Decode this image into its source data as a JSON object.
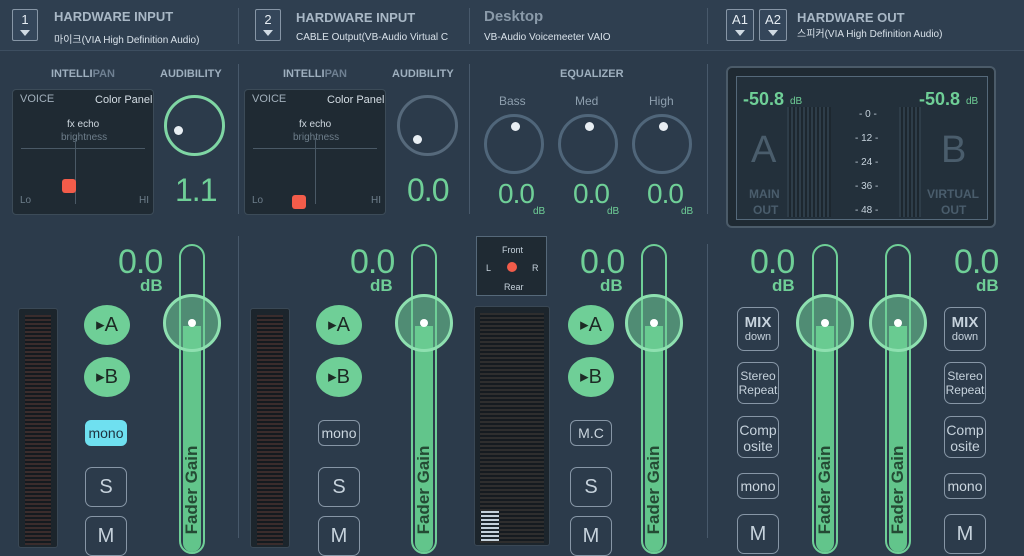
{
  "header": {
    "strip1": {
      "num": "1",
      "title": "HARDWARE INPUT",
      "device": "마이크(VIA High Definition Audio)"
    },
    "strip2": {
      "num": "2",
      "title": "HARDWARE INPUT",
      "device": "CABLE Output(VB-Audio Virtual C"
    },
    "virtual": {
      "title": "Desktop",
      "device": "VB-Audio Voicemeeter VAIO"
    },
    "out": {
      "a1": "A1",
      "a2": "A2",
      "title": "HARDWARE OUT",
      "device": "스피커(VIA High Definition Audio)"
    }
  },
  "strip1": {
    "intellipan_a": "INTELLI",
    "intellipan_b": "PAN",
    "audibility_label": "AUDIBILITY",
    "voice": "VOICE",
    "color_panel": "Color Panel",
    "fx": "fx echo",
    "bright": "brightness",
    "lo": "Lo",
    "hi": "HI",
    "audibility_value": "1.1",
    "gain": "0.0",
    "gain_unit": "dB",
    "bus_a": "A",
    "bus_b": "B",
    "mono": "mono",
    "solo": "S",
    "mute": "M",
    "fader": "Fader Gain"
  },
  "strip2": {
    "intellipan_a": "INTELLI",
    "intellipan_b": "PAN",
    "audibility_label": "AUDIBILITY",
    "voice": "VOICE",
    "color_panel": "Color Panel",
    "fx": "fx echo",
    "bright": "brightness",
    "lo": "Lo",
    "hi": "HI",
    "audibility_value": "0.0",
    "gain": "0.0",
    "gain_unit": "dB",
    "bus_a": "A",
    "bus_b": "B",
    "mono": "mono",
    "solo": "S",
    "mute": "M",
    "fader": "Fader Gain"
  },
  "virtual": {
    "eq_label": "EQUALIZER",
    "bass": "Bass",
    "med": "Med",
    "high": "High",
    "bass_val": "0.0",
    "med_val": "0.0",
    "high_val": "0.0",
    "db": "dB",
    "front": "Front",
    "rear": "Rear",
    "l": "L",
    "r": "R",
    "gain": "0.0",
    "gain_unit": "dB",
    "bus_a": "A",
    "bus_b": "B",
    "mc": "M.C",
    "solo": "S",
    "mute": "M",
    "fader": "Fader Gain"
  },
  "out": {
    "level_a": "-50.8",
    "level_b": "-50.8",
    "db": "dB",
    "big_a": "A",
    "big_b": "B",
    "main": "MAIN",
    "out_word": "OUT",
    "virtual_word": "VIRTUAL",
    "scale": [
      "- 0 -",
      "- 12 -",
      "- 24 -",
      "- 36 -",
      "- 48 -"
    ],
    "a1_gain": "0.0",
    "a2_gain": "0.0",
    "gain_unit": "dB",
    "mix": "MIX",
    "down": "down",
    "stereo": "Stereo",
    "repeat": "Repeat",
    "comp": "Comp",
    "osite": "osite",
    "mono": "mono",
    "mute": "M",
    "fader": "Fader Gain"
  },
  "colors": {
    "accent": "#6fcf97",
    "mono_on": "#6fe0f0",
    "bg": "#2c3b4b"
  }
}
